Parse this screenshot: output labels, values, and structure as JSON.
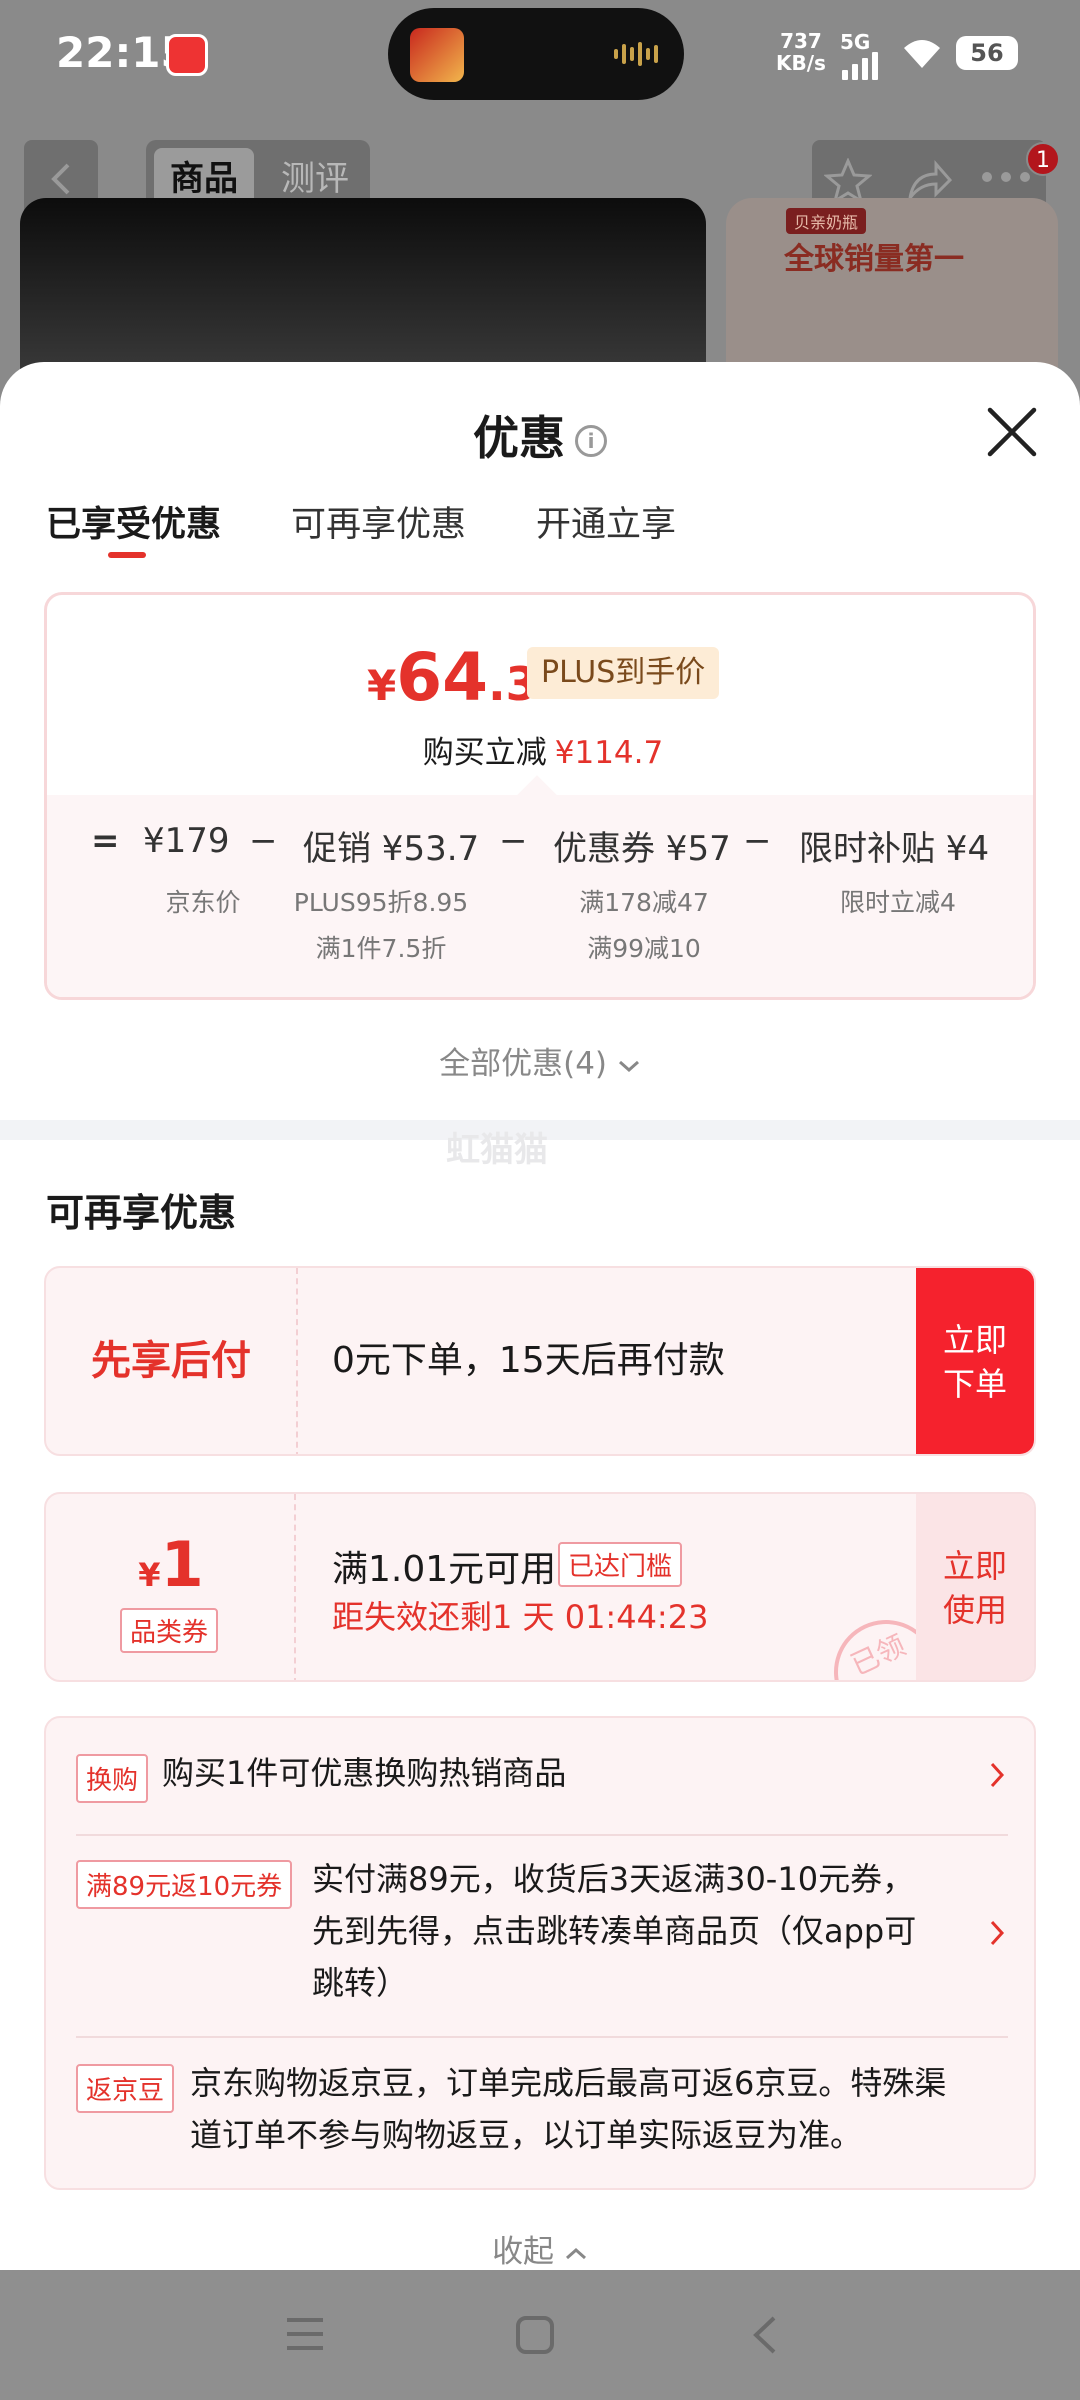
{
  "status_bar": {
    "time": "22:15",
    "speed_value": "737",
    "speed_unit": "KB/s",
    "network": "5G",
    "battery": "56"
  },
  "product_header": {
    "tab_goods": "商品",
    "tab_reviews": "测评",
    "badge_count": "1",
    "promo_tag": "贝亲奶瓶",
    "promo_text": "全球销量第一"
  },
  "sheet": {
    "title": "优惠",
    "tabs": [
      "已享受优惠",
      "可再享优惠",
      "开通立享"
    ],
    "price": {
      "currency": "¥",
      "integer": "64",
      "decimal": ".3",
      "plus_label": "PLUS到手价",
      "reduce_label": "购买立减",
      "reduce_amount": "¥114.7"
    },
    "breakdown": {
      "eq": "=",
      "minus": "−",
      "jd_price": "¥179",
      "jd_price_label": "京东价",
      "promo": "促销 ¥53.7",
      "promo_note_1": "PLUS95折8.95",
      "promo_note_2": "满1件7.5折",
      "coupon": "优惠券 ¥57",
      "coupon_note_1": "满178减47",
      "coupon_note_2": "满99减10",
      "subsidy": "限时补贴 ¥4",
      "subsidy_note": "限时立减4"
    },
    "all_deals": "全部优惠(4)",
    "watermark": "虹猫猫",
    "section_title": "可再享优惠",
    "pay_later": {
      "title": "先享后付",
      "desc": "0元下单，15天后再付款",
      "btn_line1": "立即",
      "btn_line2": "下单"
    },
    "coupon_card": {
      "currency": "¥",
      "amount": "1",
      "type": "品类券",
      "condition": "满1.01元可用",
      "reached": "已达门槛",
      "countdown": "距失效还剩1 天 01:44:23",
      "btn_line1": "立即",
      "btn_line2": "使用",
      "stamp": "已领"
    },
    "list": [
      {
        "tag": "换购",
        "text": "购买1件可优惠换购热销商品"
      },
      {
        "tag": "满89元返10元券",
        "text_line1": "实付满89元，收货后3天返满30-10元券，",
        "text_line2": "先到先得，点击跳转凑单商品页（仅app可",
        "text_line3": "跳转）"
      },
      {
        "tag": "返京豆",
        "text_line1": "京东购物返京豆，订单完成后最高可返6京豆。特殊渠",
        "text_line2": "道订单不参与购物返豆，以订单实际返豆为准。"
      }
    ],
    "collapse": "收起"
  }
}
